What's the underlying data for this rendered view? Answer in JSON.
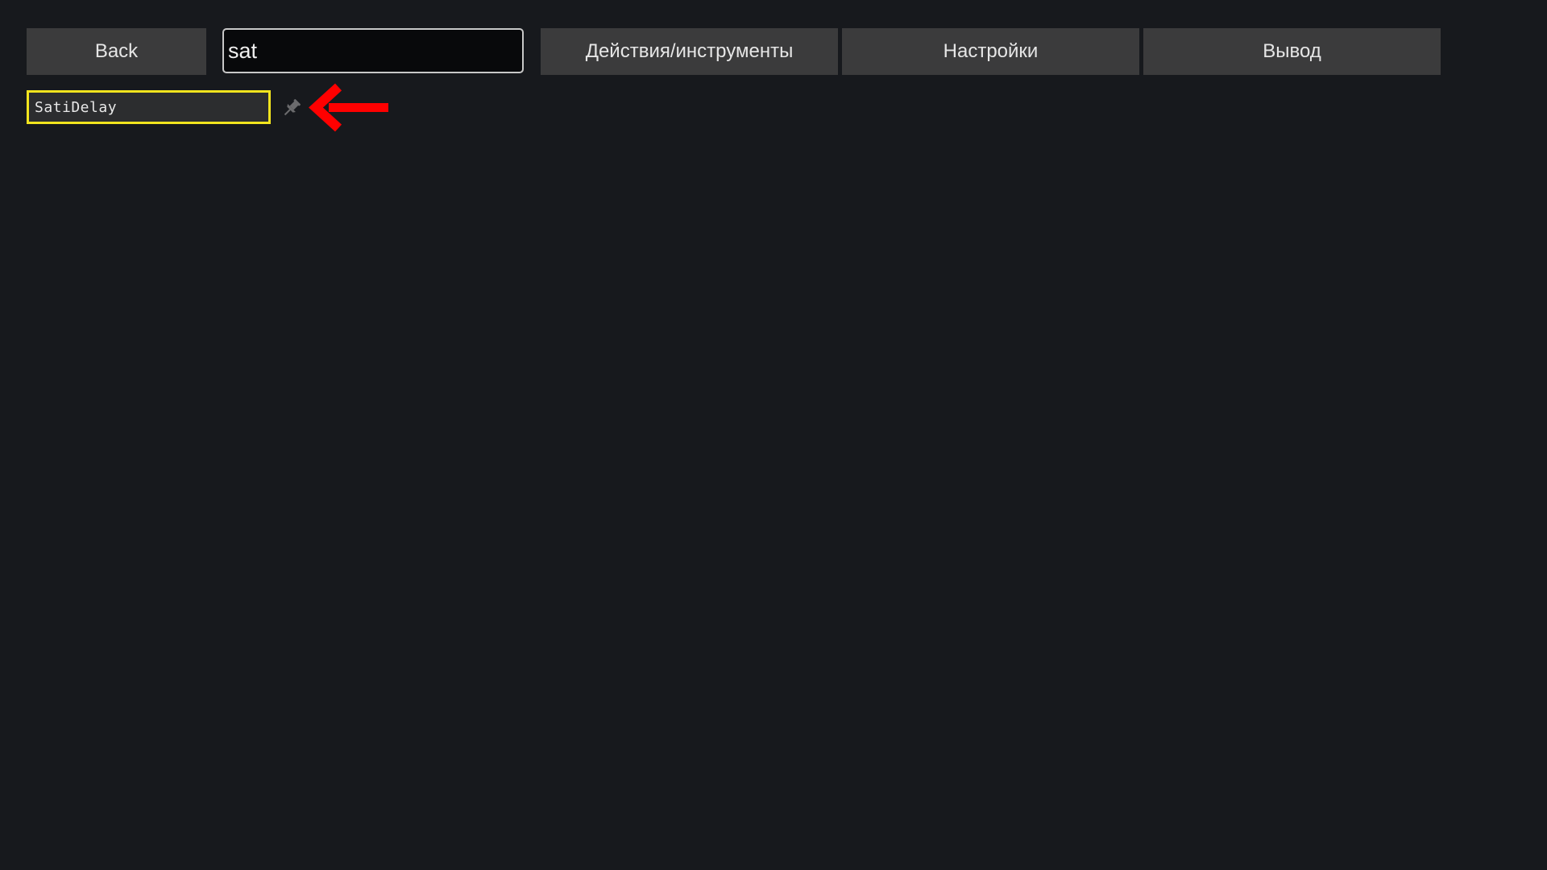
{
  "toolbar": {
    "back_label": "Back",
    "search_value": "sat"
  },
  "tabs": [
    {
      "label": "Действия/инструменты"
    },
    {
      "label": "Настройки"
    },
    {
      "label": "Вывод"
    }
  ],
  "results": [
    {
      "label": "SatiDelay",
      "highlight_color": "#f2e41e"
    }
  ],
  "icons": {
    "pin": "pin-icon",
    "arrow": "left-arrow-icon"
  },
  "colors": {
    "background": "#17191d",
    "button": "#3b3b3c",
    "highlight": "#f2e41e",
    "arrow": "#ff0000"
  }
}
